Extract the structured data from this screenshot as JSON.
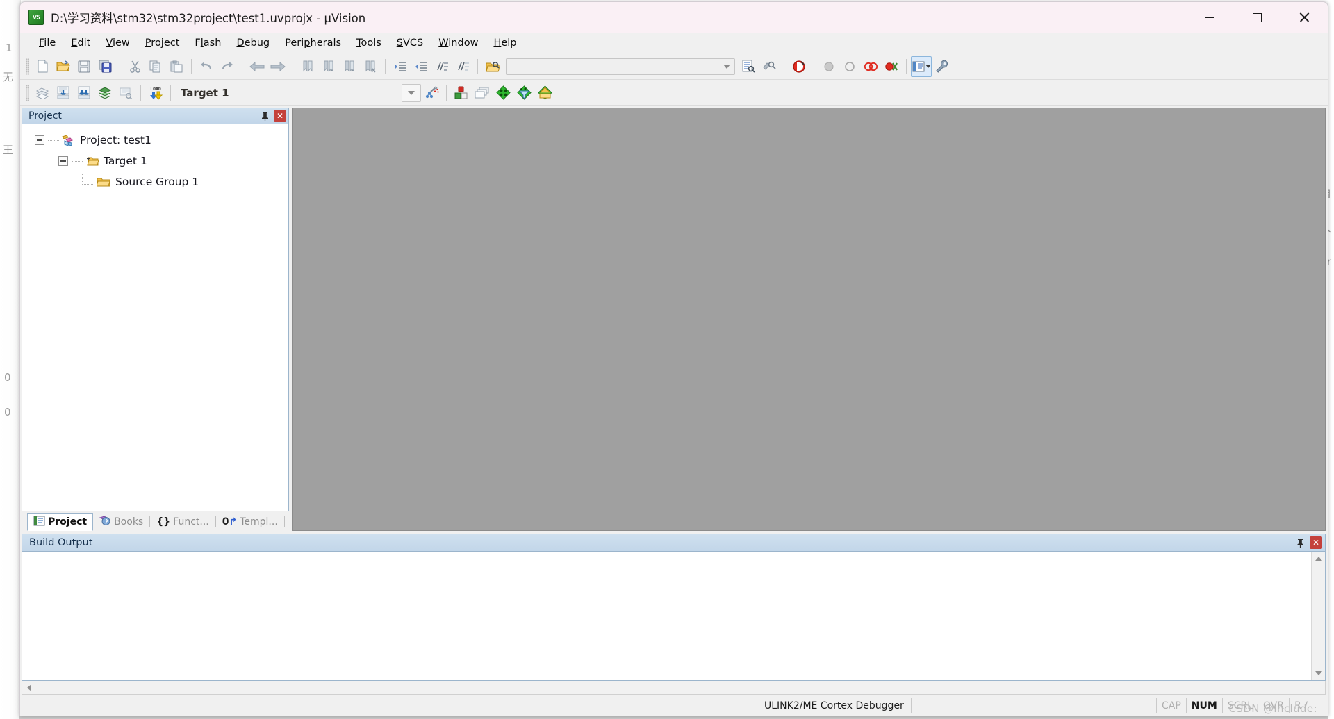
{
  "window": {
    "title": "D:\\学习资料\\stm32\\stm32project\\test1.uvprojx - µVision",
    "app_icon_label": "V5",
    "minimize_label": "Minimize",
    "maximize_label": "Maximize",
    "close_label": "Close",
    "titlebar_color": "#faf0f5"
  },
  "menubar": {
    "items": [
      {
        "label": "File",
        "accel": "F"
      },
      {
        "label": "Edit",
        "accel": "E"
      },
      {
        "label": "View",
        "accel": "V"
      },
      {
        "label": "Project",
        "accel": "P"
      },
      {
        "label": "Flash",
        "accel": "l"
      },
      {
        "label": "Debug",
        "accel": "D"
      },
      {
        "label": "Peripherals",
        "accel": "p"
      },
      {
        "label": "Tools",
        "accel": "T"
      },
      {
        "label": "SVCS",
        "accel": "S"
      },
      {
        "label": "Window",
        "accel": "W"
      },
      {
        "label": "Help",
        "accel": "H"
      }
    ]
  },
  "toolbar_file": {
    "buttons": [
      {
        "name": "new-file-icon",
        "tooltip": "New"
      },
      {
        "name": "open-file-icon",
        "tooltip": "Open"
      },
      {
        "name": "save-icon",
        "tooltip": "Save"
      },
      {
        "name": "save-all-icon",
        "tooltip": "Save All"
      },
      {
        "name": "cut-icon",
        "tooltip": "Cut"
      },
      {
        "name": "copy-icon",
        "tooltip": "Copy"
      },
      {
        "name": "paste-icon",
        "tooltip": "Paste"
      },
      {
        "name": "undo-icon",
        "tooltip": "Undo"
      },
      {
        "name": "redo-icon",
        "tooltip": "Redo"
      },
      {
        "name": "navigate-back-icon",
        "tooltip": "Back"
      },
      {
        "name": "navigate-forward-icon",
        "tooltip": "Forward"
      },
      {
        "name": "bookmark-toggle-icon",
        "tooltip": "Insert/Remove Bookmark"
      },
      {
        "name": "bookmark-prev-icon",
        "tooltip": "Previous Bookmark"
      },
      {
        "name": "bookmark-next-icon",
        "tooltip": "Next Bookmark"
      },
      {
        "name": "bookmark-clear-icon",
        "tooltip": "Clear All Bookmarks"
      },
      {
        "name": "indent-increase-icon",
        "tooltip": "Indent Selection"
      },
      {
        "name": "indent-decrease-icon",
        "tooltip": "Unindent Selection"
      },
      {
        "name": "comment-icon",
        "tooltip": "Comment Selection"
      },
      {
        "name": "uncomment-icon",
        "tooltip": "Uncomment Selection"
      },
      {
        "name": "find-in-files-icon",
        "tooltip": "Find in Files"
      }
    ],
    "search_box_value": "",
    "search_box_placeholder": "",
    "after_search_buttons": [
      {
        "name": "incremental-find-icon",
        "tooltip": "Incremental Find"
      },
      {
        "name": "find-replace-icon",
        "tooltip": "Find and Replace"
      },
      {
        "name": "debug-session-icon",
        "tooltip": "Start/Stop Debug Session"
      },
      {
        "name": "insert-breakpoint-icon",
        "tooltip": "Insert/Remove Breakpoint"
      },
      {
        "name": "disable-breakpoint-icon",
        "tooltip": "Enable/Disable Breakpoint"
      },
      {
        "name": "disable-all-breakpoints-icon",
        "tooltip": "Disable All Breakpoints"
      },
      {
        "name": "kill-all-breakpoints-icon",
        "tooltip": "Kill All Breakpoints"
      },
      {
        "name": "configuration-wizard-icon",
        "tooltip": "Configuration Wizard"
      },
      {
        "name": "options-wrench-icon",
        "tooltip": "Configure"
      }
    ]
  },
  "toolbar_build": {
    "buttons": [
      {
        "name": "translate-icon",
        "tooltip": "Translate Current File"
      },
      {
        "name": "build-icon",
        "tooltip": "Build"
      },
      {
        "name": "rebuild-icon",
        "tooltip": "Rebuild"
      },
      {
        "name": "batch-build-icon",
        "tooltip": "Batch Build"
      },
      {
        "name": "stop-build-icon",
        "tooltip": "Stop Build"
      },
      {
        "name": "download-icon",
        "tooltip": "Download"
      }
    ],
    "target_label": "Target 1",
    "target_dropdown_icon": "chevron-down-icon",
    "after_target_buttons": [
      {
        "name": "target-options-wizard-icon",
        "tooltip": "Select Target"
      },
      {
        "name": "manage-project-items-icon",
        "tooltip": "Manage Project Items"
      },
      {
        "name": "manage-multi-project-icon",
        "tooltip": "Manage Multi-Project Workspace"
      },
      {
        "name": "pack-installer-icon",
        "tooltip": "Pack Installer"
      },
      {
        "name": "run-time-env-icon",
        "tooltip": "Manage Run-Time Environment"
      },
      {
        "name": "software-packs-icon",
        "tooltip": "Select Software Packs"
      }
    ]
  },
  "project_pane": {
    "title": "Project",
    "pin_icon": "pin-icon",
    "close_icon": "close-icon",
    "tree": [
      {
        "label": "Project: test1",
        "level": 1,
        "icon": "project-icon",
        "expander": "minus"
      },
      {
        "label": "Target 1",
        "level": 2,
        "icon": "target-folder-icon",
        "expander": "minus"
      },
      {
        "label": "Source Group 1",
        "level": 3,
        "icon": "folder-icon",
        "expander": "none"
      }
    ],
    "tabs": [
      {
        "label": "Project",
        "icon": "project-tab-icon",
        "selected": true
      },
      {
        "label": "Books",
        "icon": "books-tab-icon",
        "selected": false
      },
      {
        "label": "Funct...",
        "icon": "functions-tab-icon",
        "selected": false
      },
      {
        "label": "Templ...",
        "icon": "templates-tab-icon",
        "selected": false
      }
    ]
  },
  "build_output": {
    "title": "Build Output",
    "pin_icon": "pin-icon",
    "close_icon": "close-icon",
    "text": ""
  },
  "statusbar": {
    "message": "",
    "debugger": "ULINK2/ME Cortex Debugger",
    "extra_cell": "",
    "indicators": [
      {
        "label": "CAP",
        "active": false
      },
      {
        "label": "NUM",
        "active": true
      },
      {
        "label": "SCRL",
        "active": false
      },
      {
        "label": "OVR",
        "active": false
      },
      {
        "label": "R /",
        "active": false
      }
    ]
  },
  "watermark": "CSDN @include:",
  "background": {
    "ghost_labels": [
      "王",
      "1",
      "无",
      "0",
      "0"
    ],
    "right_labels": [
      "自",
      "入",
      "ir"
    ]
  }
}
